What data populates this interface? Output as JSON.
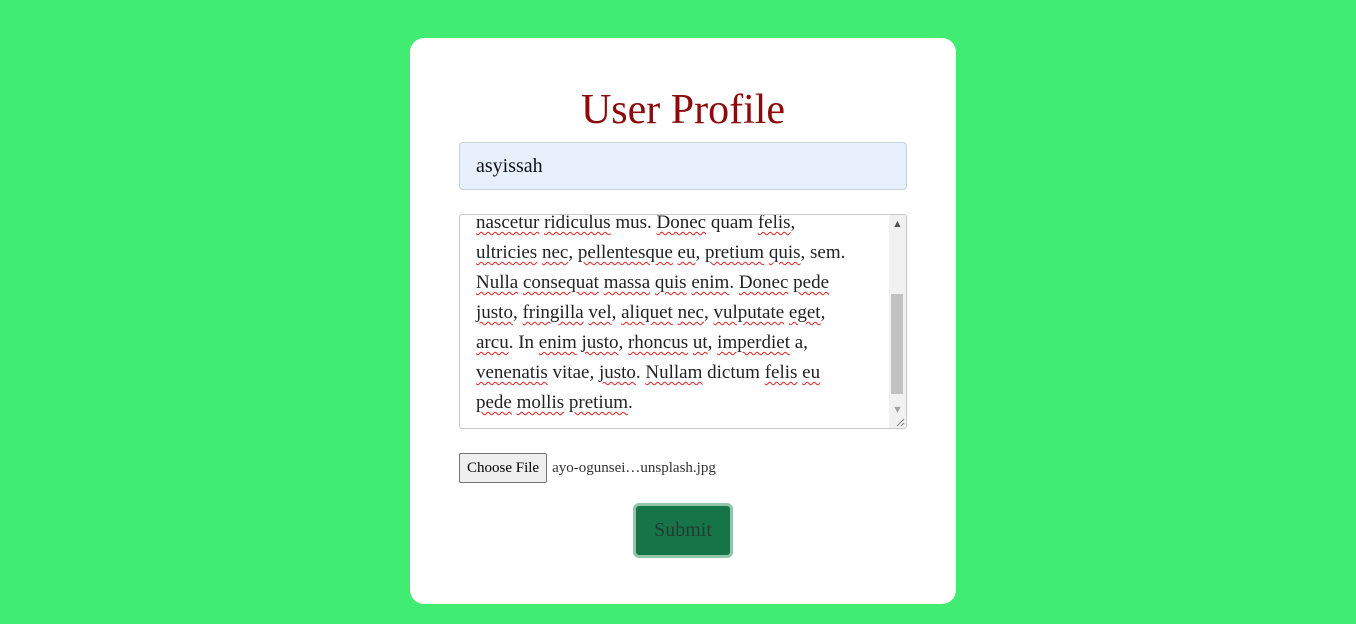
{
  "form": {
    "title": "User Profile",
    "username_value": "asyissah",
    "bio_lines": [
      [
        {
          "t": "nascetur",
          "s": true
        },
        {
          "t": " "
        },
        {
          "t": "ridiculus",
          "s": true
        },
        {
          "t": " mus. "
        },
        {
          "t": "Donec",
          "s": true
        },
        {
          "t": " quam "
        },
        {
          "t": "felis",
          "s": true
        },
        {
          "t": ","
        }
      ],
      [
        {
          "t": "ultricies",
          "s": true
        },
        {
          "t": " "
        },
        {
          "t": "nec",
          "s": true
        },
        {
          "t": ", "
        },
        {
          "t": "pellentesque",
          "s": true
        },
        {
          "t": " "
        },
        {
          "t": "eu",
          "s": true
        },
        {
          "t": ", "
        },
        {
          "t": "pretium",
          "s": true
        },
        {
          "t": " "
        },
        {
          "t": "quis",
          "s": true
        },
        {
          "t": ", sem."
        }
      ],
      [
        {
          "t": "Nulla",
          "s": true
        },
        {
          "t": " "
        },
        {
          "t": "consequat",
          "s": true
        },
        {
          "t": " "
        },
        {
          "t": "massa",
          "s": true
        },
        {
          "t": " "
        },
        {
          "t": "quis",
          "s": true
        },
        {
          "t": " "
        },
        {
          "t": "enim",
          "s": true
        },
        {
          "t": ". "
        },
        {
          "t": "Donec",
          "s": true
        },
        {
          "t": " "
        },
        {
          "t": "pede",
          "s": true
        }
      ],
      [
        {
          "t": "justo",
          "s": true
        },
        {
          "t": ", "
        },
        {
          "t": "fringilla",
          "s": true
        },
        {
          "t": " "
        },
        {
          "t": "vel",
          "s": true
        },
        {
          "t": ", "
        },
        {
          "t": "aliquet",
          "s": true
        },
        {
          "t": " "
        },
        {
          "t": "nec",
          "s": true
        },
        {
          "t": ", "
        },
        {
          "t": "vulputate",
          "s": true
        },
        {
          "t": " "
        },
        {
          "t": "eget",
          "s": true
        },
        {
          "t": ","
        }
      ],
      [
        {
          "t": "arcu",
          "s": true
        },
        {
          "t": ". In "
        },
        {
          "t": "enim",
          "s": true
        },
        {
          "t": " "
        },
        {
          "t": "justo",
          "s": true
        },
        {
          "t": ", "
        },
        {
          "t": "rhoncus",
          "s": true
        },
        {
          "t": " "
        },
        {
          "t": "ut",
          "s": true
        },
        {
          "t": ", "
        },
        {
          "t": "imperdiet",
          "s": true
        },
        {
          "t": " a,"
        }
      ],
      [
        {
          "t": "venenatis",
          "s": true
        },
        {
          "t": " vitae, "
        },
        {
          "t": "justo",
          "s": true
        },
        {
          "t": ". "
        },
        {
          "t": "Nullam",
          "s": true
        },
        {
          "t": " dictum "
        },
        {
          "t": "felis",
          "s": true
        },
        {
          "t": " "
        },
        {
          "t": "eu",
          "s": true
        }
      ],
      [
        {
          "t": "pede",
          "s": true
        },
        {
          "t": " "
        },
        {
          "t": "mollis",
          "s": true
        },
        {
          "t": " "
        },
        {
          "t": "pretium",
          "s": true
        },
        {
          "t": "."
        }
      ]
    ],
    "file": {
      "button_label": "Choose File",
      "file_name": "ayo-ogunsei…unsplash.jpg"
    },
    "submit_label": "Submit"
  },
  "colors": {
    "background": "#41ec73",
    "title": "#8b0a0a",
    "submit_bg": "#167548",
    "input_bg": "#e8f0fe"
  },
  "icons": {
    "scroll_up": "triangle-up-icon",
    "scroll_down": "triangle-down-icon",
    "resize": "resize-grip-icon"
  }
}
